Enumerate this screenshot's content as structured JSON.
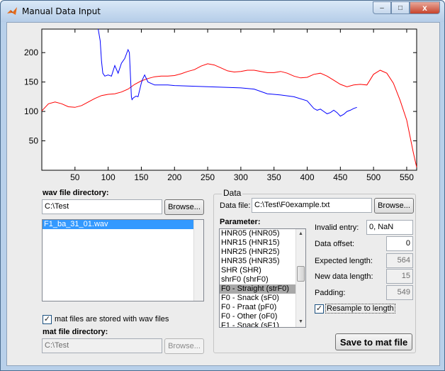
{
  "window": {
    "title": "Manual Data Input",
    "close_glyph": "x",
    "max_glyph": "□",
    "min_glyph": "–"
  },
  "chart_data": {
    "type": "line",
    "xlim": [
      0,
      565
    ],
    "ylim": [
      0,
      240
    ],
    "xticks": [
      50,
      100,
      150,
      200,
      250,
      300,
      350,
      400,
      450,
      500,
      550
    ],
    "yticks": [
      50,
      100,
      150,
      200
    ],
    "grid": false,
    "series": [
      {
        "color": "#ff0000",
        "x": [
          0,
          10,
          20,
          30,
          40,
          50,
          60,
          70,
          80,
          90,
          100,
          110,
          120,
          130,
          140,
          150,
          160,
          170,
          180,
          190,
          200,
          210,
          220,
          230,
          240,
          250,
          260,
          270,
          280,
          290,
          300,
          310,
          320,
          330,
          340,
          350,
          360,
          370,
          380,
          390,
          400,
          410,
          420,
          430,
          440,
          450,
          460,
          470,
          480,
          490,
          500,
          510,
          520,
          530,
          540,
          550,
          560,
          565
        ],
        "y": [
          101,
          113,
          116,
          113,
          108,
          107,
          110,
          116,
          122,
          127,
          129,
          130,
          133,
          138,
          146,
          152,
          156,
          159,
          160,
          160,
          161,
          164,
          168,
          171,
          177,
          181,
          179,
          174,
          169,
          167,
          168,
          170,
          170,
          168,
          166,
          166,
          168,
          165,
          160,
          157,
          158,
          163,
          165,
          160,
          153,
          146,
          142,
          145,
          146,
          145,
          163,
          170,
          165,
          148,
          119,
          85,
          30,
          5
        ]
      },
      {
        "color": "#0000ff",
        "x": [
          85,
          88,
          90,
          92,
          95,
          100,
          105,
          110,
          115,
          120,
          125,
          130,
          132,
          134,
          135,
          136,
          138,
          142,
          145,
          150,
          152,
          155,
          160,
          170,
          180,
          190,
          200,
          250,
          300,
          320,
          340,
          360,
          380,
          400,
          410,
          415,
          420,
          425,
          430,
          435,
          440,
          445,
          450,
          455,
          460,
          465,
          470,
          475
        ],
        "y": [
          240,
          220,
          185,
          165,
          160,
          162,
          160,
          178,
          165,
          182,
          190,
          205,
          200,
          150,
          125,
          120,
          123,
          126,
          125,
          148,
          155,
          162,
          150,
          145,
          145,
          145,
          144,
          142,
          140,
          138,
          130,
          128,
          125,
          118,
          105,
          102,
          104,
          100,
          96,
          98,
          102,
          98,
          92,
          95,
          100,
          102,
          105,
          107
        ]
      }
    ]
  },
  "wav": {
    "dir_label": "wav file directory:",
    "dir_value": "C:\\Test",
    "browse_label": "Browse...",
    "files": [
      "F1_ba_31_01.wav"
    ],
    "mat_checkbox_label": "mat files are stored with wav files",
    "mat_checkbox_glyph": "✓",
    "mat_dir_label": "mat file directory:",
    "mat_dir_value": "C:\\Test",
    "mat_browse_label": "Browse..."
  },
  "data": {
    "group_title": "Data",
    "file_label": "Data file:",
    "file_value": "C:\\Test\\F0example.txt",
    "browse_label": "Browse...",
    "param_label": "Parameter:",
    "parameters": [
      "HNR05 (HNR05)",
      "HNR15 (HNR15)",
      "HNR25 (HNR25)",
      "HNR35 (HNR35)",
      "SHR (SHR)",
      "shrF0 (shrF0)",
      "F0 - Straight (strF0)",
      "F0 - Snack (sF0)",
      "F0 - Praat (pF0)",
      "F0 - Other (oF0)",
      "F1 - Snack (sF1)"
    ],
    "selected_parameter": "F0 - Straight (strF0)",
    "invalid_label": "Invalid entry:",
    "invalid_value": "0, NaN",
    "offset_label": "Data offset:",
    "offset_value": "0",
    "expected_label": "Expected length:",
    "expected_value": "564",
    "newlen_label": "New data length:",
    "newlen_value": "15",
    "padding_label": "Padding:",
    "padding_value": "549",
    "resample_label": "Resample to length",
    "resample_glyph": "✓",
    "save_label": "Save to mat file"
  }
}
